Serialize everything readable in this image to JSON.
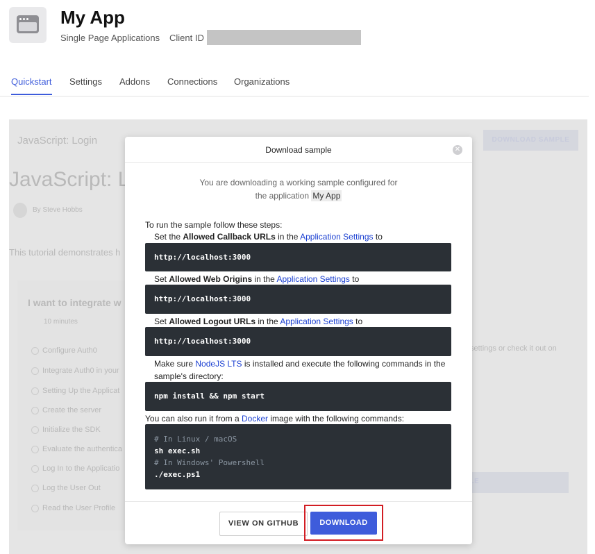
{
  "header": {
    "app_name": "My App",
    "app_type": "Single Page Applications",
    "client_id_label": "Client ID"
  },
  "tabs": [
    {
      "label": "Quickstart",
      "active": true
    },
    {
      "label": "Settings",
      "active": false
    },
    {
      "label": "Addons",
      "active": false
    },
    {
      "label": "Connections",
      "active": false
    },
    {
      "label": "Organizations",
      "active": false
    }
  ],
  "background": {
    "link": "JavaScript: Login",
    "heading": "JavaScript: L",
    "author": "By Steve Hobbs",
    "intro": "This tutorial demonstrates h",
    "download_sample": "DOWNLOAD SAMPLE",
    "integrate": "I want to integrate w",
    "minutes": "10 minutes",
    "steps": [
      "Configure Auth0",
      "Integrate Auth0 in your",
      "Setting Up the Applicat",
      "Create the server",
      "Initialize the SDK",
      "Evaluate the authentica",
      "Log In to the Applicatio",
      "Log the User Out",
      "Read the User Profile"
    ],
    "right_text": "settings or check it out on",
    "right_btn": "LE"
  },
  "modal": {
    "title": "Download sample",
    "intro_line1": "You are downloading a working sample configured for",
    "intro_line2_prefix": "the application",
    "intro_app_name": "My App",
    "steps_intro": "To run the sample follow these steps:",
    "step1": {
      "prefix": "Set the",
      "bold": "Allowed Callback URLs",
      "middle": "in the",
      "link": "Application Settings",
      "suffix": "to"
    },
    "step2": {
      "prefix": "Set",
      "bold": "Allowed Web Origins",
      "middle": "in the",
      "link": "Application Settings",
      "suffix": "to"
    },
    "step3": {
      "prefix": "Set",
      "bold": "Allowed Logout URLs",
      "middle": "in the",
      "link": "Application Settings",
      "suffix": "to"
    },
    "code_url": "http://localhost:3000",
    "step4": {
      "prefix": "Make sure",
      "link": "NodeJS LTS",
      "suffix": "is installed and execute the following commands in the sample's directory:"
    },
    "code_npm": "npm install && npm start",
    "docker": {
      "prefix": "You can also run it from a",
      "link": "Docker",
      "suffix": "image with the following commands:"
    },
    "docker_code": {
      "comment_linux": "# In Linux / macOS",
      "cmd_linux": "sh exec.sh",
      "comment_windows": "# In Windows' Powershell",
      "cmd_windows": "./exec.ps1"
    },
    "buttons": {
      "github": "VIEW ON GITHUB",
      "download": "DOWNLOAD"
    }
  },
  "colors": {
    "accent": "#3e5cdb",
    "code_bg": "#2b3036",
    "highlight": "#d21d23"
  }
}
